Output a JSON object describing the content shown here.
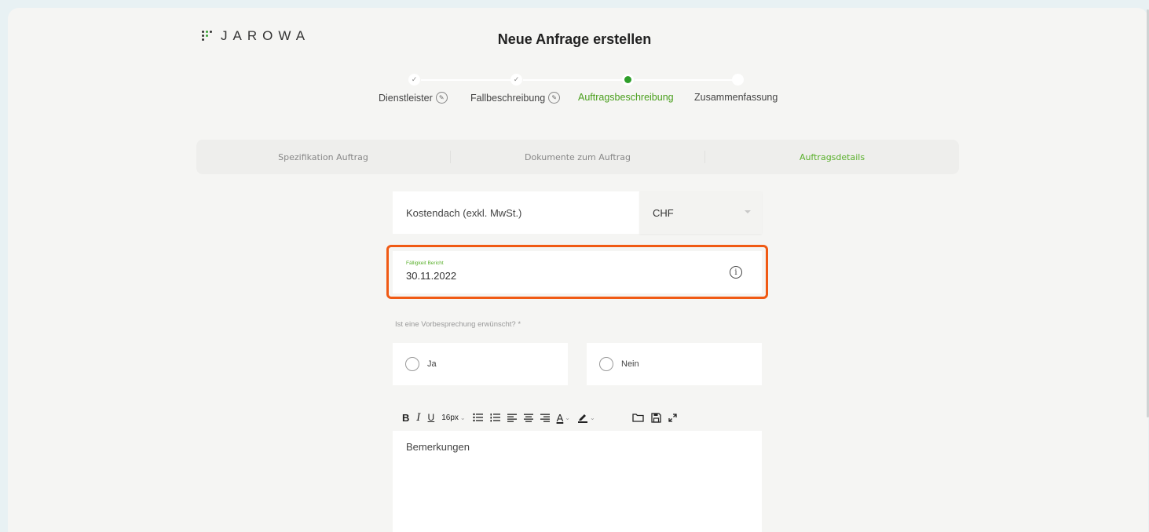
{
  "header": {
    "logo_text": "JAROWA",
    "page_title": "Neue Anfrage erstellen"
  },
  "stepper": {
    "steps": [
      {
        "label": "Dienstleister",
        "state": "done"
      },
      {
        "label": "Fallbeschreibung",
        "state": "done"
      },
      {
        "label": "Auftragsbeschreibung",
        "state": "active"
      },
      {
        "label": "Zusammenfassung",
        "state": "pending"
      }
    ]
  },
  "subtabs": [
    {
      "label": "Spezifikation Auftrag"
    },
    {
      "label": "Dokumente zum Auftrag"
    },
    {
      "label": "Auftragsdetails"
    }
  ],
  "form": {
    "cost_cap_placeholder": "Kostendach (exkl. MwSt.)",
    "currency_value": "CHF",
    "due_date_label": "Fälligkeit Bericht",
    "due_date_value": "30.11.2022",
    "meeting_question": "Ist eine Vorbesprechung erwünscht? *",
    "option_yes": "Ja",
    "option_no": "Nein",
    "remarks_placeholder": "Bemerkungen"
  },
  "editor_toolbar": {
    "bold": "B",
    "italic": "I",
    "underline": "U",
    "font_size": "16px",
    "font_color": "A"
  },
  "colors": {
    "accent_green": "#5ab02c",
    "highlight_orange": "#f05a14"
  }
}
